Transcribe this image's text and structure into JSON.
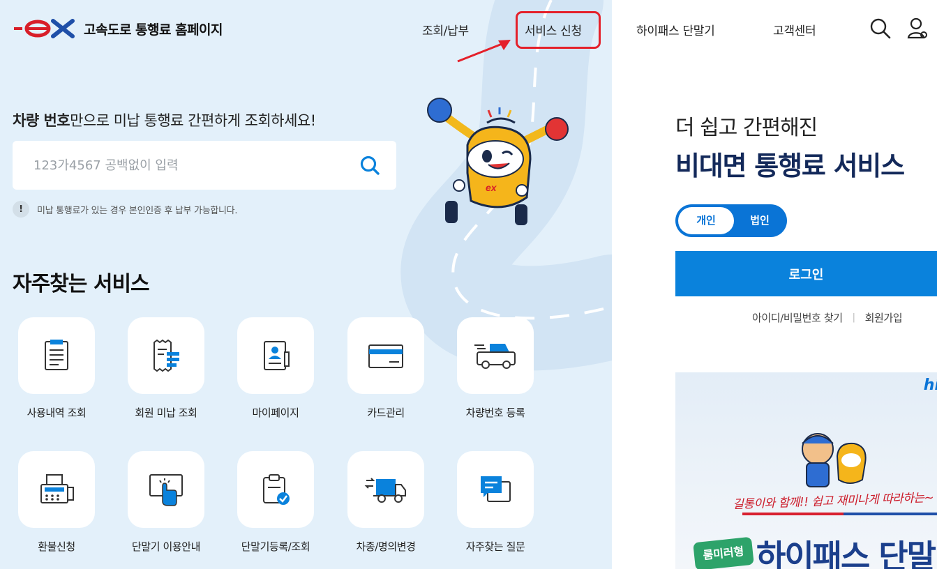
{
  "header": {
    "logo_text": "고속도로 통행료 홈페이지",
    "nav": [
      "조회/납부",
      "서비스 신청",
      "하이패스 단말기",
      "고객센터"
    ]
  },
  "search": {
    "headline_bold": "차량 번호",
    "headline_rest": "만으로 미납 통행료 간편하게 조회하세요!",
    "placeholder": "123가4567 공백없이 입력",
    "notice": "미납 통행료가 있는 경우 본인인증 후 납부 가능합니다.",
    "notice_icon": "!"
  },
  "services": {
    "title": "자주찾는 서비스",
    "items": [
      {
        "label": "사용내역 조회",
        "icon": "document-list-icon"
      },
      {
        "label": "회원 미납 조회",
        "icon": "receipt-icon"
      },
      {
        "label": "마이페이지",
        "icon": "profile-card-icon"
      },
      {
        "label": "카드관리",
        "icon": "credit-card-icon"
      },
      {
        "label": "차량번호 등록",
        "icon": "car-icon"
      },
      {
        "label": "환불신청",
        "icon": "fax-machine-icon"
      },
      {
        "label": "단말기 이용안내",
        "icon": "touch-screen-icon"
      },
      {
        "label": "단말기등록/조회",
        "icon": "clipboard-check-icon"
      },
      {
        "label": "차종/명의변경",
        "icon": "truck-exchange-icon"
      },
      {
        "label": "자주찾는 질문",
        "icon": "chat-bubbles-icon"
      }
    ]
  },
  "login_panel": {
    "subtitle": "더 쉽고 간편해진",
    "title": "비대면 통행료 서비스",
    "toggle": [
      "개인",
      "법인"
    ],
    "login_button": "로그인",
    "links": [
      "아이디/비밀번호 찾기",
      "회원가입"
    ]
  },
  "banner": {
    "logo": "hi",
    "caption": "길통이와 함께!! 쉽고 재미나게 따라하는~",
    "tag": "룸미러형",
    "headline": "하이패스 단말"
  },
  "colors": {
    "accent": "#0a82dc",
    "navy": "#13295a",
    "highlight_red": "#e4202a",
    "left_bg": "#e3f0fa"
  }
}
